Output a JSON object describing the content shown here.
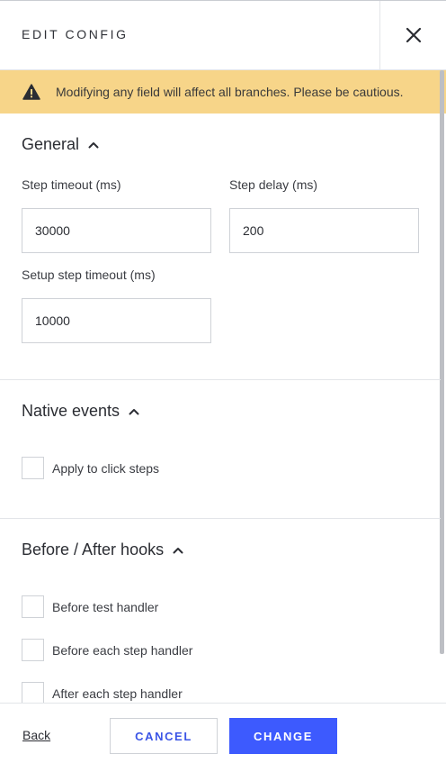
{
  "header": {
    "title": "EDIT CONFIG",
    "close_icon": "close-icon"
  },
  "warning": {
    "icon": "warning-triangle-icon",
    "text": "Modifying any field will affect all branches. Please be cautious.",
    "background": "#f7d589"
  },
  "sections": {
    "general": {
      "title": "General",
      "fields": [
        {
          "label": "Step timeout (ms)",
          "value": "30000"
        },
        {
          "label": "Step delay (ms)",
          "value": "200"
        },
        {
          "label": "Setup step timeout (ms)",
          "value": "10000"
        }
      ]
    },
    "native_events": {
      "title": "Native events",
      "checkboxes": [
        {
          "label": "Apply to click steps",
          "checked": false
        }
      ]
    },
    "hooks": {
      "title": "Before / After hooks",
      "checkboxes": [
        {
          "label": "Before test handler",
          "checked": false
        },
        {
          "label": "Before each step handler",
          "checked": false
        },
        {
          "label": "After each step handler",
          "checked": false
        }
      ]
    }
  },
  "footer": {
    "back_label": "Back",
    "cancel_label": "CANCEL",
    "change_label": "CHANGE",
    "accent_color": "#3d5afe"
  }
}
